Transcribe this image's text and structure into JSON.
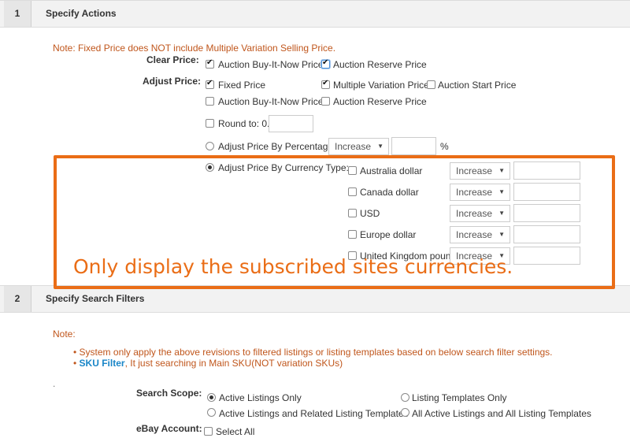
{
  "section1": {
    "number": "1",
    "title": "Specify Actions",
    "note": "Note: Fixed Price does NOT include Multiple Variation Selling Price.",
    "clear_price": {
      "label": "Clear Price:",
      "options": [
        {
          "label": "Auction Buy-It-Now Price",
          "checked": true
        },
        {
          "label": "Auction Reserve Price",
          "checked": true
        }
      ]
    },
    "adjust_price": {
      "label": "Adjust Price:",
      "row1": [
        {
          "label": "Fixed Price",
          "checked": true
        },
        {
          "label": "Multiple Variation Price",
          "checked": true
        },
        {
          "label": "Auction Start Price",
          "checked": false
        }
      ],
      "row2": [
        {
          "label": "Auction Buy-It-Now Price",
          "checked": false
        },
        {
          "label": "Auction Reserve Price",
          "checked": false
        }
      ],
      "round_to": {
        "label": "Round to: 0.",
        "checked": false,
        "value": ""
      },
      "by_percentage": {
        "label": "Adjust Price By Percentage",
        "selected": false,
        "select": "Increase",
        "value": "",
        "unit": "%"
      },
      "by_currency": {
        "label": "Adjust Price By Currency Type:",
        "selected": true,
        "currencies": [
          {
            "label": "Australia dollar",
            "select": "Increase",
            "value": ""
          },
          {
            "label": "Canada dollar",
            "select": "Increase",
            "value": ""
          },
          {
            "label": "USD",
            "select": "Increase",
            "value": ""
          },
          {
            "label": "Europe dollar",
            "select": "Increase",
            "value": ""
          },
          {
            "label": "United Kingdom pound",
            "select": "Increase",
            "value": ""
          }
        ]
      }
    },
    "annotation": "Only display the subscribed sites currencies.",
    "annotation_color": "#ea6d16"
  },
  "section2": {
    "number": "2",
    "title": "Specify Search Filters",
    "note": "Note:",
    "bullets": [
      {
        "text": "System only apply the above revisions to filtered listings or listing templates based on below search filter settings."
      },
      {
        "link": "SKU Filter",
        "text": ", It just searching in Main SKU(NOT variation SKUs)"
      }
    ],
    "dot": ".",
    "search_scope": {
      "label": "Search Scope:",
      "options": [
        {
          "label": "Active Listings Only",
          "selected": true
        },
        {
          "label": "Listing Templates Only",
          "selected": false
        },
        {
          "label": "Active Listings and Related Listing Templates",
          "selected": false
        },
        {
          "label": "All Active Listings and All Listing Templates",
          "selected": false
        }
      ]
    },
    "ebay_account": {
      "label": "eBay Account:",
      "select_all": "Select All",
      "checked": false
    }
  }
}
